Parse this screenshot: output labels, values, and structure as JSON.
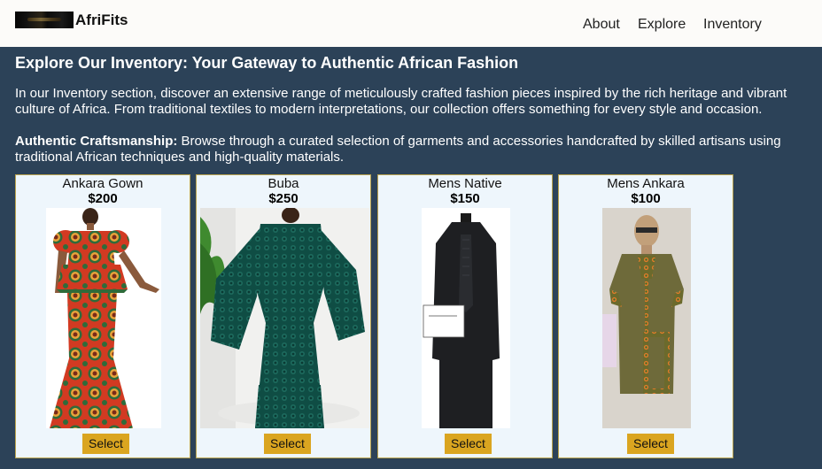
{
  "header": {
    "brand": "AfriFits",
    "nav": [
      {
        "label": "About"
      },
      {
        "label": "Explore"
      },
      {
        "label": "Inventory"
      }
    ]
  },
  "main": {
    "title": "Explore Our Inventory: Your Gateway to Authentic African Fashion",
    "intro": "In our Inventory section, discover an extensive range of meticulously crafted fashion pieces inspired by the rich heritage and vibrant culture of Africa. From traditional textiles to modern interpretations, our collection offers something for every style and occasion.",
    "craft_label": "Authentic Craftsmanship:",
    "craft_text": " Browse through a curated selection of garments and accessories handcrafted by skilled artisans using traditional African techniques and high-quality materials."
  },
  "products": [
    {
      "name": "Ankara Gown",
      "price": "$200",
      "button": "Select"
    },
    {
      "name": "Buba",
      "price": "$250",
      "button": "Select"
    },
    {
      "name": "Mens Native",
      "price": "$150",
      "button": "Select"
    },
    {
      "name": "Mens Ankara",
      "price": "$100",
      "button": "Select"
    }
  ],
  "colors": {
    "header_bg": "#fcfbf9",
    "page_bg": "#2c4258",
    "card_bg": "#eef6fc",
    "card_border": "#b9a24d",
    "button_bg": "#daa520"
  }
}
